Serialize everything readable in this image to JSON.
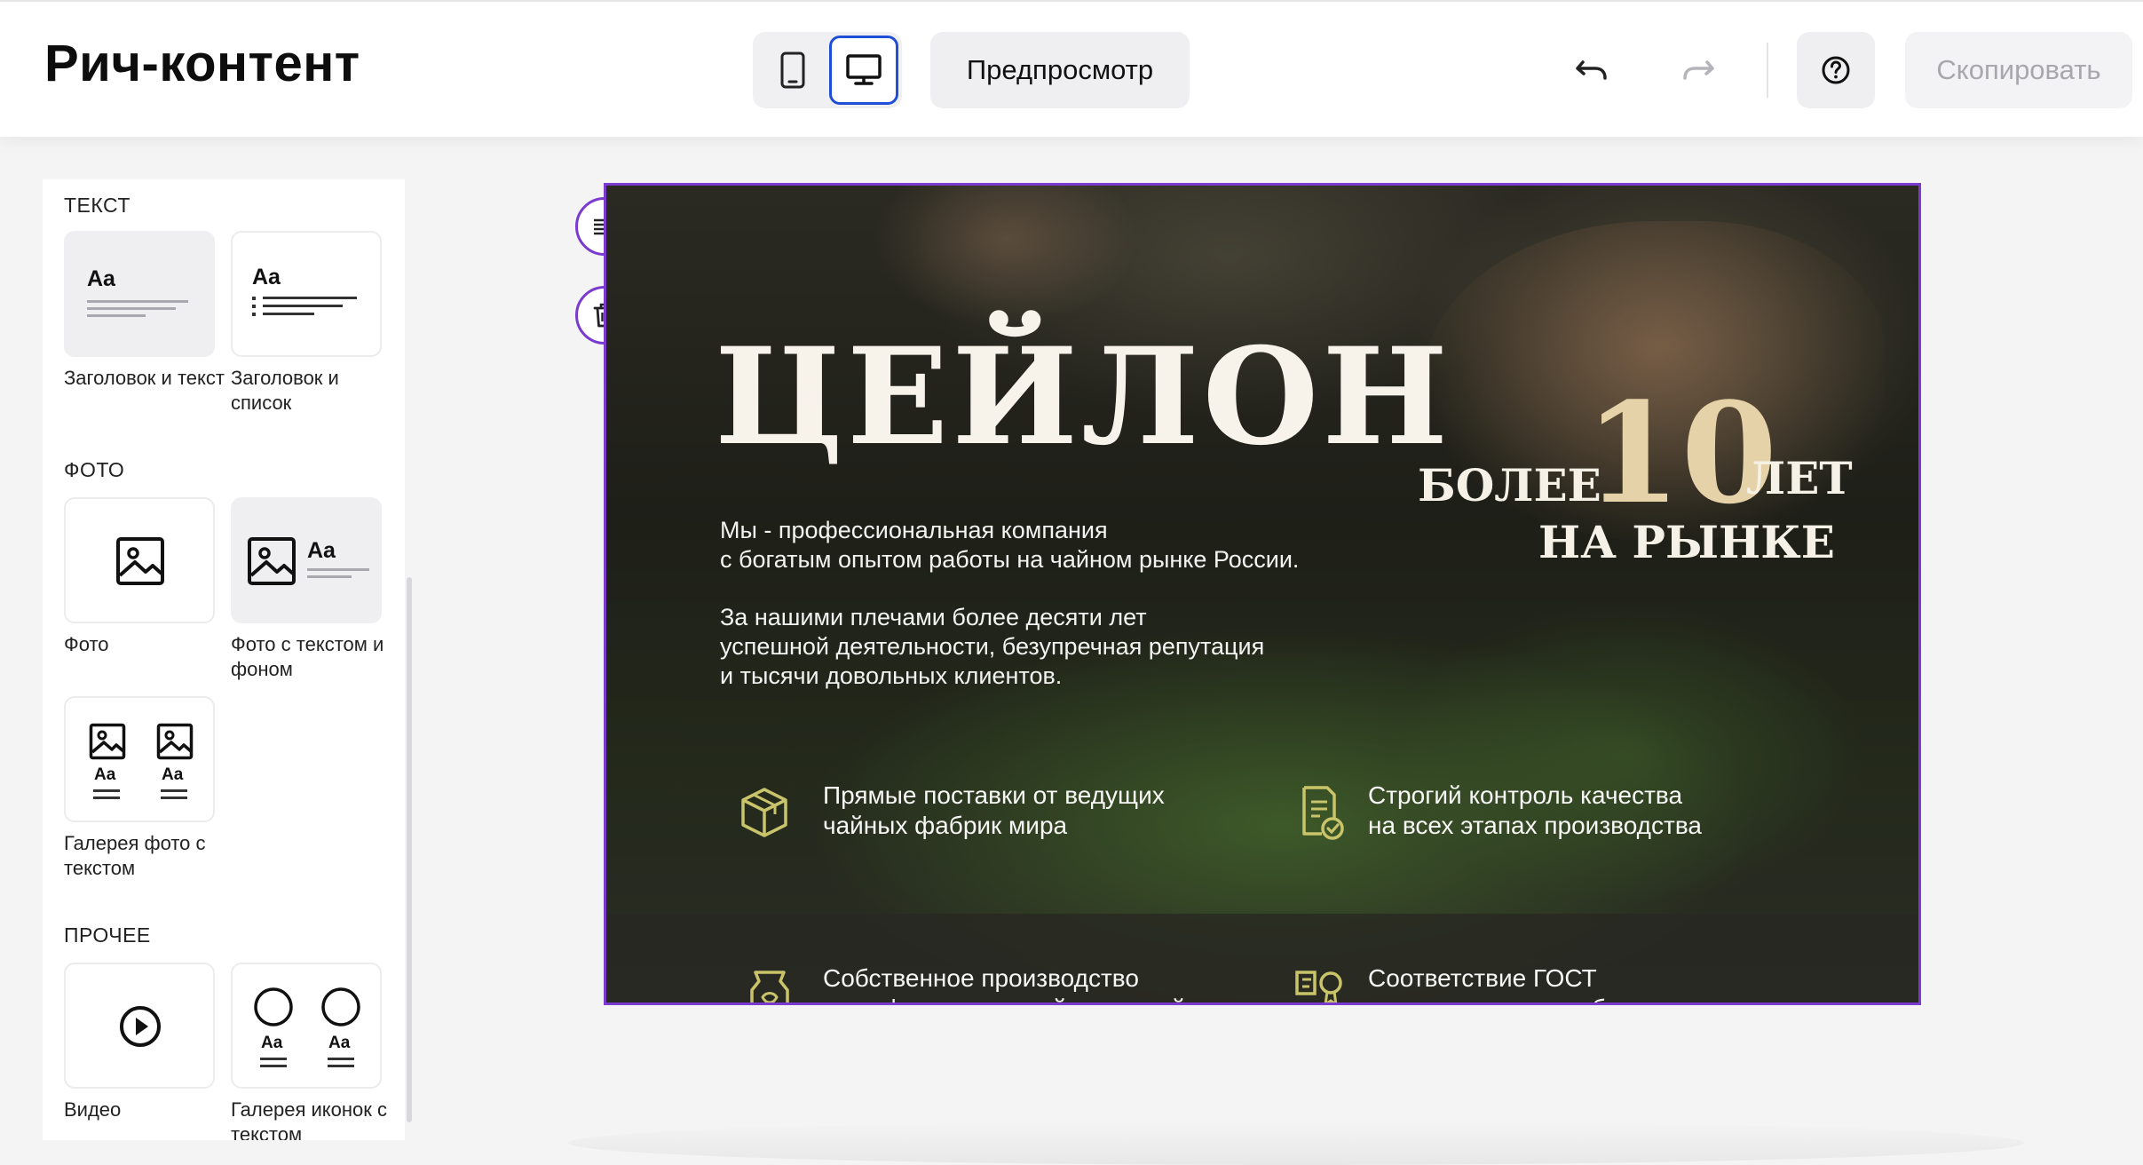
{
  "header": {
    "title": "Рич-контент",
    "preview_label": "Предпросмотр",
    "copy_label": "Скопировать"
  },
  "sidebar": {
    "sections": [
      {
        "title": "ТЕКСТ",
        "blocks": [
          {
            "label": "Заголовок и текст",
            "icon": "heading-text-icon",
            "tile_text": "Aa"
          },
          {
            "label": "Заголовок и список",
            "icon": "heading-list-icon",
            "tile_text": "Aa"
          }
        ]
      },
      {
        "title": "ФОТО",
        "blocks": [
          {
            "label": "Фото",
            "icon": "image-icon"
          },
          {
            "label": "Фото с текстом и фоном",
            "icon": "image-text-icon",
            "tile_text": "Aa"
          },
          {
            "label": "Галерея фото с текстом",
            "icon": "photo-gallery-icon",
            "tile_text": "Aa"
          }
        ]
      },
      {
        "title": "ПРОЧЕЕ",
        "blocks": [
          {
            "label": "Видео",
            "icon": "play-icon"
          },
          {
            "label": "Галерея иконок с текстом",
            "icon": "icon-gallery-icon",
            "tile_text": "Aa"
          }
        ]
      }
    ]
  },
  "banner": {
    "title": "ЦЕЙЛОН",
    "paragraph1": [
      "Мы - профессиональная компания",
      "с богатым опытом работы на чайном рынке России."
    ],
    "paragraph2": [
      "За нашими плечами более десяти лет",
      "успешной деятельности, безупречная репутация",
      "и тысячи довольных клиентов."
    ],
    "badge": {
      "pre": "БОЛЕЕ",
      "number": "10",
      "post": "ЛЕТ",
      "sub": "НА РЫНКЕ"
    },
    "features": [
      {
        "icon": "box-icon",
        "lines": [
          "Прямые поставки от ведущих",
          "чайных фабрик мира"
        ]
      },
      {
        "icon": "quality-check-icon",
        "lines": [
          "Строгий контроль качества",
          "на всех этапах производства"
        ]
      },
      {
        "icon": "tea-pack-icon",
        "lines": [
          "Собственное производство",
          "с профессиональной командой"
        ]
      },
      {
        "icon": "standard-icon",
        "lines": [
          "Соответствие ГОСТ",
          "и наличие всех необходимых"
        ]
      }
    ]
  },
  "colors": {
    "accent_blue": "#1f4fd6",
    "selection_purple": "#7a3ad0",
    "badge_gold": "#e6d2a8",
    "feature_icon": "#c9c46a"
  }
}
